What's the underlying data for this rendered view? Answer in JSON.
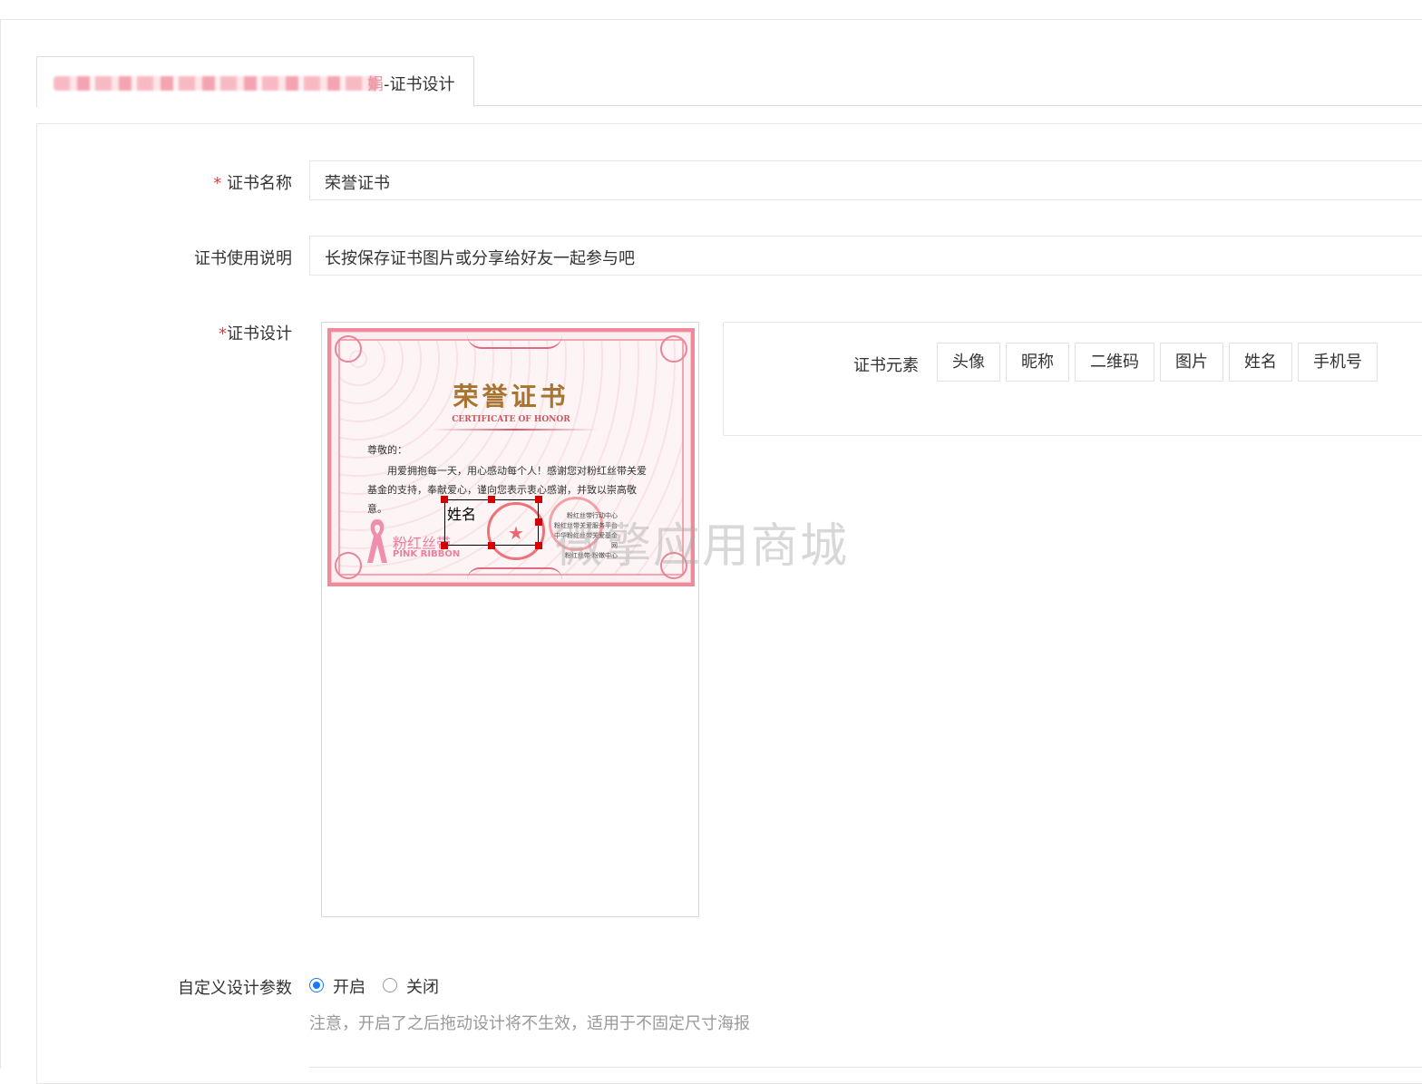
{
  "tab": {
    "title_suffix": "-证书设计",
    "title_prefix_visible": "娟"
  },
  "form": {
    "name_label": "证书名称",
    "name_required": "*",
    "name_value": "荣誉证书",
    "desc_label": "证书使用说明",
    "desc_value": "长按保存证书图片或分享给好友一起参与吧",
    "design_label": "证书设计",
    "design_required": "*"
  },
  "certificate": {
    "title": "荣誉证书",
    "subtitle": "CERTIFICATE OF HONOR",
    "greeting": "尊敬的：",
    "body": "用爱拥抱每一天，用心感动每个人！感谢您对粉红丝带关爱基金的支持，奉献爱心，谨向您表示衷心感谢，并致以崇高敬意。",
    "logo_cn": "粉红丝带",
    "logo_en": "PINK RIBBON",
    "sign_lines": [
      "粉红丝带行动中心",
      "粉红丝带关爱服务平台",
      "中华粉红丝带关爱基金网",
      "粉红丝带·粉嫩中心"
    ],
    "selected_element": "姓名",
    "colors": {
      "border": "#f08a99",
      "title": "#a8742f",
      "seal": "#e8535f"
    }
  },
  "elements": {
    "label": "证书元素",
    "buttons": [
      "头像",
      "昵称",
      "二维码",
      "图片",
      "姓名",
      "手机号"
    ]
  },
  "custom_params": {
    "label": "自定义设计参数",
    "options": [
      "开启",
      "关闭"
    ],
    "selected": "开启",
    "note": "注意，开启了之后拖动设计将不生效，适用于不固定尺寸海报"
  },
  "watermark": "微擎应用商城",
  "accent_color": "#1677ff"
}
